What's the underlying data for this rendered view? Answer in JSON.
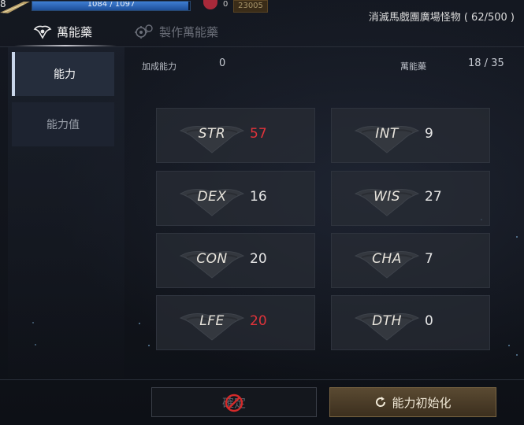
{
  "status": {
    "level": "8",
    "hp_text": "1084 / 1097",
    "hp_fraction": 0.988,
    "currency_count": "0",
    "currency_box": "23005",
    "quest_text": "消滅馬戲團廣場怪物 ( 62/500 )"
  },
  "tabs": [
    {
      "label": "萬能藥",
      "icon": "elixir-icon"
    },
    {
      "label": "製作萬能藥",
      "icon": "craft-gear-icon"
    }
  ],
  "sidebar": {
    "items": [
      {
        "label": "能力"
      },
      {
        "label": "能力值"
      }
    ]
  },
  "header": {
    "bonus_label": "加成能力",
    "bonus_value": "0",
    "elixir_label": "萬能藥",
    "elixir_value": "18 / 35"
  },
  "stats": [
    {
      "name": "STR",
      "value": "57",
      "low": true
    },
    {
      "name": "INT",
      "value": "9",
      "low": false
    },
    {
      "name": "DEX",
      "value": "16",
      "low": false
    },
    {
      "name": "WIS",
      "value": "27",
      "low": false
    },
    {
      "name": "CON",
      "value": "20",
      "low": false
    },
    {
      "name": "CHA",
      "value": "7",
      "low": false
    },
    {
      "name": "LFE",
      "value": "20",
      "low": true
    },
    {
      "name": "DTH",
      "value": "0",
      "low": false
    }
  ],
  "buttons": {
    "confirm_label": "確定",
    "reset_label": "能力初始化"
  },
  "colors": {
    "low_value": "#e0333a",
    "accent_gold": "#7a6542"
  }
}
